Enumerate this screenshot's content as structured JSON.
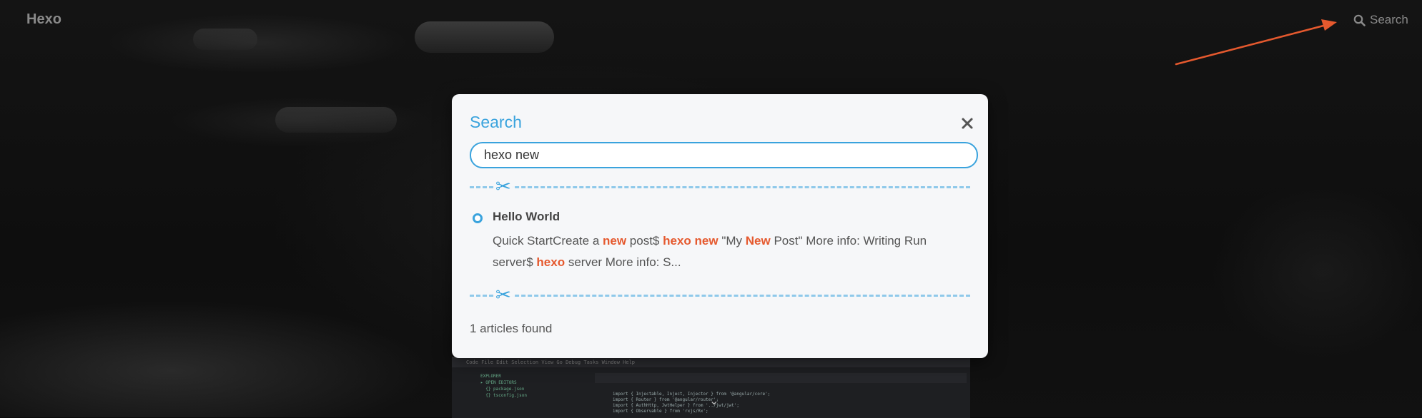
{
  "header": {
    "brand": "Hexo",
    "search_label": "Search"
  },
  "background": {
    "menu_text": "Code  File  Edit  Selection  View  Go  Debug  Tasks  Window  Help",
    "side_text": "EXPLORER\n▸ OPEN EDITORS\n  {} package.json\n  {} tsconfig.json",
    "code_text": "import { Injectable, Inject, Injector } from '@angular/core';\nimport { Router } from '@angular/router';\nimport { AuthHttp, JwtHelper } from '../jwt/jwt';\nimport { Observable } from 'rxjs/Rx';"
  },
  "modal": {
    "title": "Search",
    "close_icon": "close-icon",
    "query": "hexo new",
    "divider_icon": "scissors-icon",
    "results": [
      {
        "title": "Hello World",
        "snippet_parts": [
          {
            "text": "Quick StartCreate a ",
            "hl": false
          },
          {
            "text": "new",
            "hl": true
          },
          {
            "text": " post$ ",
            "hl": false
          },
          {
            "text": "hexo",
            "hl": true
          },
          {
            "text": " ",
            "hl": false
          },
          {
            "text": "new",
            "hl": true
          },
          {
            "text": " \"My ",
            "hl": false
          },
          {
            "text": "New",
            "hl": true
          },
          {
            "text": " Post\" More info: Writing Run server$ ",
            "hl": false
          },
          {
            "text": "hexo",
            "hl": true
          },
          {
            "text": " server More info: S...",
            "hl": false
          }
        ]
      }
    ],
    "count_text": "1 articles found"
  },
  "colors": {
    "accent": "#3aa3dd",
    "highlight": "#e5592e",
    "annotation_arrow": "#e5592e"
  }
}
